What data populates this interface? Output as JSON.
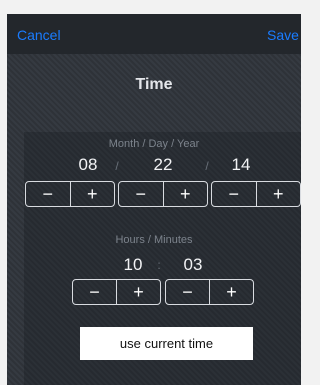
{
  "navbar": {
    "cancel_label": "Cancel",
    "save_label": "Save"
  },
  "title": "Time",
  "date": {
    "caption": "Month / Day / Year",
    "month": "08",
    "day": "22",
    "year": "14",
    "separator": "/"
  },
  "time": {
    "caption": "Hours / Minutes",
    "hours": "10",
    "minutes": "03",
    "separator": ":"
  },
  "stepper": {
    "minus_label": "−",
    "plus_label": "+"
  },
  "use_current_time_label": "use current time",
  "colors": {
    "accent": "#1a7cff",
    "navbar": "#23272c",
    "background": "#30353c"
  }
}
